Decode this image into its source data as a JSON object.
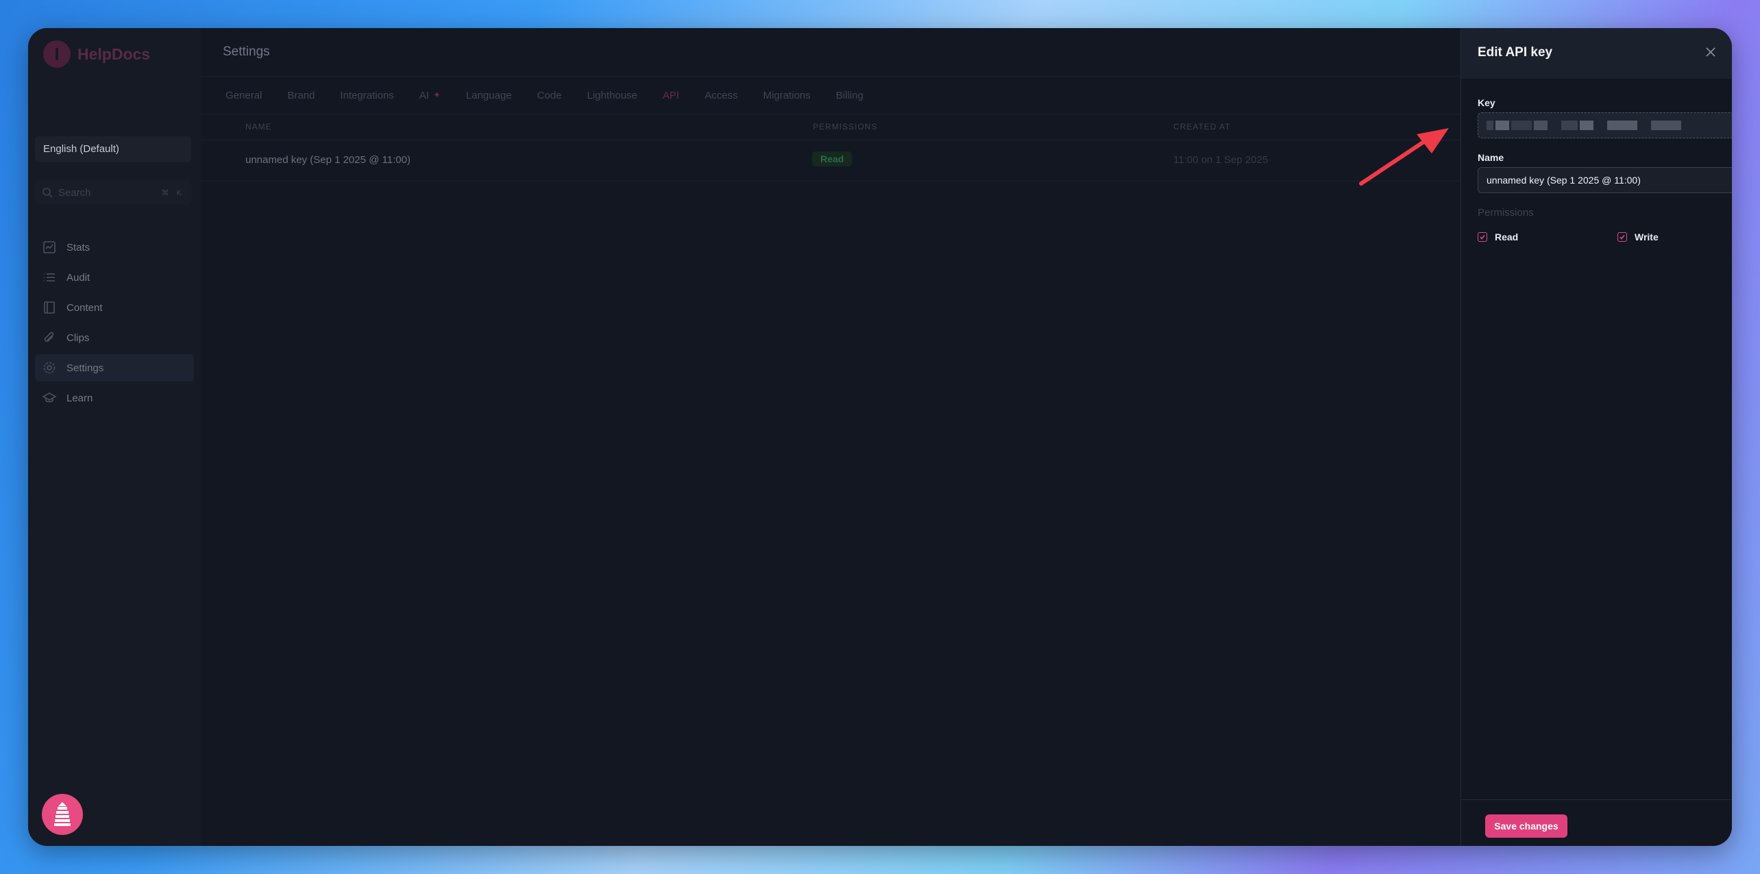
{
  "app": {
    "name": "HelpDocs"
  },
  "sidebar": {
    "language": "English (Default)",
    "search_placeholder": "Search",
    "search_shortcut": "⌘ K",
    "items": [
      {
        "label": "Stats",
        "icon": "stats-icon"
      },
      {
        "label": "Audit",
        "icon": "list-icon"
      },
      {
        "label": "Content",
        "icon": "book-icon"
      },
      {
        "label": "Clips",
        "icon": "paperclip-icon"
      },
      {
        "label": "Settings",
        "icon": "gear-icon",
        "active": true
      },
      {
        "label": "Learn",
        "icon": "graduation-cap-icon"
      }
    ]
  },
  "main": {
    "title": "Settings",
    "tabs": [
      "General",
      "Brand",
      "Integrations",
      "AI",
      "Language",
      "Code",
      "Lighthouse",
      "API",
      "Access",
      "Migrations",
      "Billing"
    ],
    "active_tab": "API",
    "table": {
      "headers": {
        "name": "NAME",
        "permissions": "PERMISSIONS",
        "created_at": "CREATED AT"
      },
      "rows": [
        {
          "name": "unnamed key (Sep 1 2025 @ 11:00)",
          "permission": "Read",
          "created_at": "11:00 on 1 Sep 2025"
        }
      ]
    }
  },
  "drawer": {
    "title": "Edit API key",
    "key_label": "Key",
    "name_label": "Name",
    "name_value": "unnamed key (Sep 1 2025 @ 11:00)",
    "permissions_label": "Permissions",
    "read_label": "Read",
    "write_label": "Write",
    "read_checked": true,
    "write_checked": true,
    "save_label": "Save changes"
  },
  "colors": {
    "accent": "#e0417d",
    "annotation_arrow": "#ef3b47"
  }
}
